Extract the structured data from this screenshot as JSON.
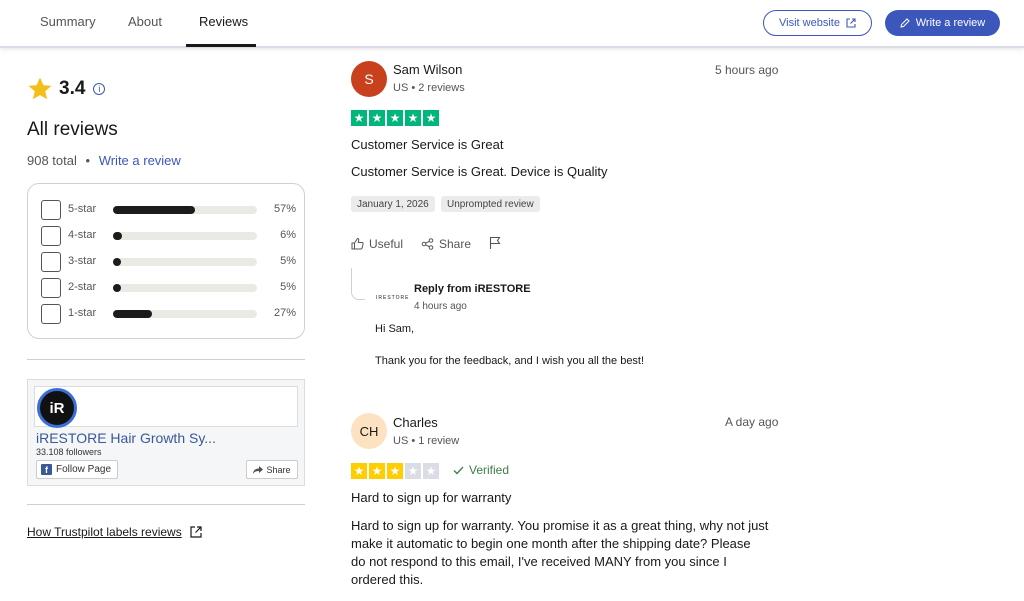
{
  "nav": {
    "tabs": [
      {
        "label": "Summary"
      },
      {
        "label": "About"
      },
      {
        "label": "Reviews"
      }
    ],
    "visit_website": "Visit website",
    "write_review": "Write a review"
  },
  "summary": {
    "rating": "3.4",
    "title": "All reviews",
    "total": "908 total",
    "write_link": "Write a review",
    "distribution": [
      {
        "label": "5-star",
        "percent": 57,
        "percent_text": "57%"
      },
      {
        "label": "4-star",
        "percent": 6,
        "percent_text": "6%"
      },
      {
        "label": "3-star",
        "percent": 5,
        "percent_text": "5%"
      },
      {
        "label": "2-star",
        "percent": 5,
        "percent_text": "5%"
      },
      {
        "label": "1-star",
        "percent": 27,
        "percent_text": "27%"
      }
    ]
  },
  "facebook": {
    "logo_text": "iR",
    "page_name": "iRESTORE Hair Growth Sy...",
    "followers": "33,108 followers",
    "follow_label": "Follow Page",
    "share_label": "Share"
  },
  "labels_link": "How Trustpilot labels reviews",
  "reviews": [
    {
      "initial": "S",
      "name": "Sam Wilson",
      "meta": "US • 2 reviews",
      "time": "5 hours ago",
      "stars": 5,
      "title": "Customer Service is Great",
      "body": "Customer Service is Great. Device is Quality",
      "date_chip": "January 1, 2026",
      "tag_chip": "Unprompted review",
      "useful": "Useful",
      "share": "Share",
      "reply": {
        "logo": "IRESTORE",
        "from": "Reply from iRESTORE",
        "time": "4 hours ago",
        "greeting": "Hi Sam,",
        "text": "Thank you for the feedback, and I wish you all the best!"
      }
    },
    {
      "initial": "CH",
      "name": "Charles",
      "meta": "US • 1 review",
      "time": "A day ago",
      "stars": 3,
      "verified": "Verified",
      "title": "Hard to sign up for warranty",
      "body_lines": [
        "Hard to sign up for warranty. You promise it as a great thing, why not just",
        "make it automatic to begin one month after the shipping date? Please",
        "do not respond to this email, I've received MANY from you since I",
        "ordered this."
      ]
    }
  ],
  "colors": {
    "accent": "#3c57bc",
    "five_star_green": "#00b67a",
    "three_star_yellow": "#ffce00",
    "empty_star": "#dcdce6",
    "avatar_s": "#c8401c",
    "avatar_ch": "#fde2c2"
  }
}
